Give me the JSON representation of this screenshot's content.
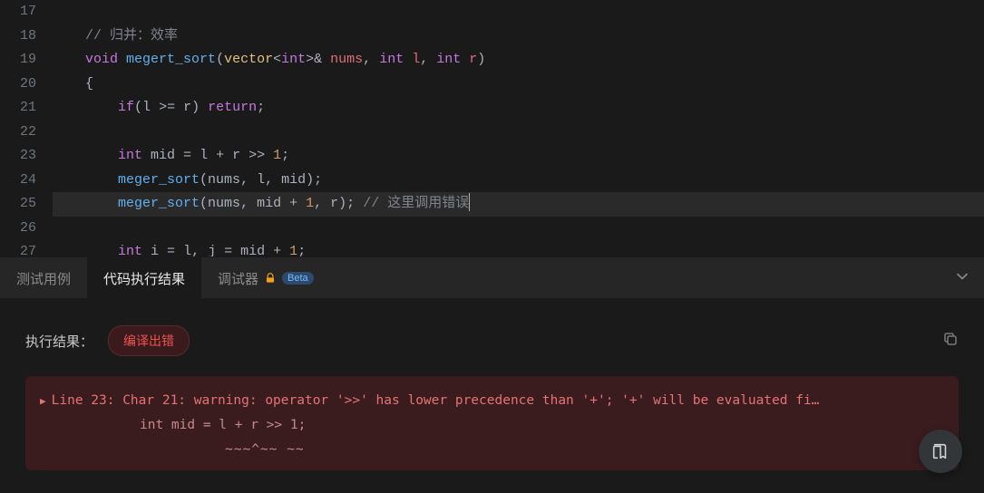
{
  "editor": {
    "lines": [
      {
        "num": "17",
        "tokens": []
      },
      {
        "num": "18",
        "tokens": [
          {
            "t": "    ",
            "c": ""
          },
          {
            "t": "// 归并：效率",
            "c": "tok-comment"
          }
        ]
      },
      {
        "num": "19",
        "tokens": [
          {
            "t": "    ",
            "c": ""
          },
          {
            "t": "void",
            "c": "tok-keyword"
          },
          {
            "t": " ",
            "c": ""
          },
          {
            "t": "megert_sort",
            "c": "tok-func"
          },
          {
            "t": "(",
            "c": "tok-punct"
          },
          {
            "t": "vector",
            "c": "tok-type"
          },
          {
            "t": "<",
            "c": "tok-punct"
          },
          {
            "t": "int",
            "c": "tok-keyword"
          },
          {
            "t": ">& ",
            "c": "tok-punct"
          },
          {
            "t": "nums",
            "c": "tok-var"
          },
          {
            "t": ", ",
            "c": "tok-punct"
          },
          {
            "t": "int",
            "c": "tok-keyword"
          },
          {
            "t": " ",
            "c": ""
          },
          {
            "t": "l",
            "c": "tok-var"
          },
          {
            "t": ", ",
            "c": "tok-punct"
          },
          {
            "t": "int",
            "c": "tok-keyword"
          },
          {
            "t": " ",
            "c": ""
          },
          {
            "t": "r",
            "c": "tok-var"
          },
          {
            "t": ")",
            "c": "tok-punct"
          }
        ]
      },
      {
        "num": "20",
        "tokens": [
          {
            "t": "    ",
            "c": ""
          },
          {
            "t": "{",
            "c": "tok-punct"
          }
        ]
      },
      {
        "num": "21",
        "tokens": [
          {
            "t": "        ",
            "c": ""
          },
          {
            "t": "if",
            "c": "tok-flow"
          },
          {
            "t": "(",
            "c": "tok-punct"
          },
          {
            "t": "l ",
            "c": "tok-ident"
          },
          {
            "t": ">=",
            "c": "tok-punct"
          },
          {
            "t": " r",
            "c": "tok-ident"
          },
          {
            "t": ") ",
            "c": "tok-punct"
          },
          {
            "t": "return",
            "c": "tok-flow"
          },
          {
            "t": ";",
            "c": "tok-punct"
          }
        ]
      },
      {
        "num": "22",
        "tokens": []
      },
      {
        "num": "23",
        "tokens": [
          {
            "t": "        ",
            "c": ""
          },
          {
            "t": "int",
            "c": "tok-keyword"
          },
          {
            "t": " mid ",
            "c": "tok-ident"
          },
          {
            "t": "=",
            "c": "tok-punct"
          },
          {
            "t": " l ",
            "c": "tok-ident"
          },
          {
            "t": "+",
            "c": "tok-punct"
          },
          {
            "t": " r ",
            "c": "tok-ident"
          },
          {
            "t": ">>",
            "c": "tok-punct"
          },
          {
            "t": " ",
            "c": ""
          },
          {
            "t": "1",
            "c": "tok-num"
          },
          {
            "t": ";",
            "c": "tok-punct"
          }
        ]
      },
      {
        "num": "24",
        "tokens": [
          {
            "t": "        ",
            "c": ""
          },
          {
            "t": "meger_sort",
            "c": "tok-func"
          },
          {
            "t": "(",
            "c": "tok-punct"
          },
          {
            "t": "nums",
            "c": "tok-ident"
          },
          {
            "t": ", ",
            "c": "tok-punct"
          },
          {
            "t": "l",
            "c": "tok-ident"
          },
          {
            "t": ", ",
            "c": "tok-punct"
          },
          {
            "t": "mid",
            "c": "tok-ident"
          },
          {
            "t": ");",
            "c": "tok-punct"
          }
        ]
      },
      {
        "num": "25",
        "hl": true,
        "cursor_after": true,
        "tokens": [
          {
            "t": "        ",
            "c": ""
          },
          {
            "t": "meger_sort",
            "c": "tok-func"
          },
          {
            "t": "(",
            "c": "tok-punct"
          },
          {
            "t": "nums",
            "c": "tok-ident"
          },
          {
            "t": ", ",
            "c": "tok-punct"
          },
          {
            "t": "mid ",
            "c": "tok-ident"
          },
          {
            "t": "+",
            "c": "tok-punct"
          },
          {
            "t": " ",
            "c": ""
          },
          {
            "t": "1",
            "c": "tok-num"
          },
          {
            "t": ", ",
            "c": "tok-punct"
          },
          {
            "t": "r",
            "c": "tok-ident"
          },
          {
            "t": "); ",
            "c": "tok-punct"
          },
          {
            "t": "// 这里调用错误",
            "c": "tok-comment"
          }
        ]
      },
      {
        "num": "26",
        "tokens": []
      },
      {
        "num": "27",
        "tokens": [
          {
            "t": "        ",
            "c": ""
          },
          {
            "t": "int",
            "c": "tok-keyword"
          },
          {
            "t": " i ",
            "c": "tok-ident"
          },
          {
            "t": "=",
            "c": "tok-punct"
          },
          {
            "t": " l",
            "c": "tok-ident"
          },
          {
            "t": ", ",
            "c": "tok-punct"
          },
          {
            "t": "j ",
            "c": "tok-ident"
          },
          {
            "t": "=",
            "c": "tok-punct"
          },
          {
            "t": " mid ",
            "c": "tok-ident"
          },
          {
            "t": "+",
            "c": "tok-punct"
          },
          {
            "t": " ",
            "c": ""
          },
          {
            "t": "1",
            "c": "tok-num"
          },
          {
            "t": ";",
            "c": "tok-punct"
          }
        ]
      }
    ]
  },
  "panel": {
    "tabs": [
      {
        "label": "测试用例",
        "active": false,
        "lock": false,
        "beta": false
      },
      {
        "label": "代码执行结果",
        "active": true,
        "lock": false,
        "beta": false
      },
      {
        "label": "调试器",
        "active": false,
        "lock": true,
        "beta": "Beta"
      }
    ],
    "result_label": "执行结果：",
    "result_status": "编译出错",
    "error": {
      "line1": "Line 23: Char 21: warning: operator '>>' has lower precedence than '+'; '+' will be evaluated fi…",
      "line2": "int mid = l + r >> 1;",
      "line3": "~~~^~~ ~~"
    }
  }
}
